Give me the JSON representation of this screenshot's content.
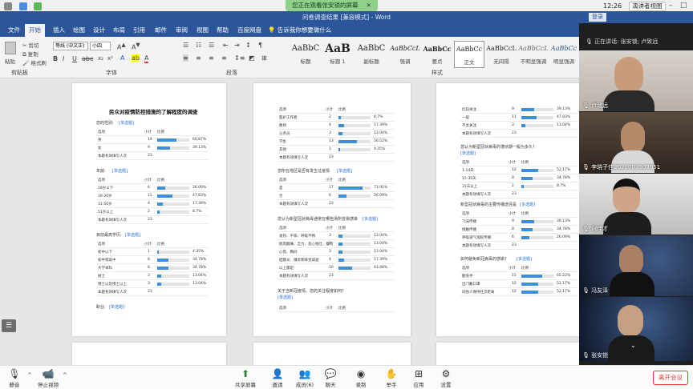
{
  "system": {
    "time": "12:26",
    "speaker_view": "演讲者视图",
    "sharing_banner": "您正在观看张安锁的屏幕"
  },
  "word": {
    "title": "问卷调查结果 [兼容模式] - Word",
    "login": "登录",
    "tabs": [
      "文件",
      "开始",
      "插入",
      "绘图",
      "设计",
      "布局",
      "引用",
      "邮件",
      "审阅",
      "视图",
      "帮助",
      "百度网盘",
      "告诉我你想要做什么"
    ],
    "clipboard": {
      "paste": "粘贴",
      "cut": "剪切",
      "copy": "复制",
      "format_painter": "格式刷",
      "group": "剪贴板"
    },
    "font": {
      "name": "等线 (中文正)",
      "size": "小四",
      "group": "字体"
    },
    "paragraph_group": "段落",
    "styles_group": "样式",
    "styles": [
      {
        "preview": "AaBbC",
        "name": "标题"
      },
      {
        "preview": "AaB",
        "name": "标题 1"
      },
      {
        "preview": "AaBbC",
        "name": "副标题"
      },
      {
        "preview": "AaBbCcL",
        "name": "强调"
      },
      {
        "preview": "AaBbCc",
        "name": "要点"
      },
      {
        "preview": "AaBbCc",
        "name": "正文"
      },
      {
        "preview": "AaBbCcL",
        "name": "无间隔"
      },
      {
        "preview": "AaBbCcL",
        "name": "不明显强调"
      },
      {
        "preview": "AaBbCc",
        "name": "明显强调"
      }
    ]
  },
  "doc": {
    "page1": {
      "title": "民众对疫情防控措施的了解程度的调查",
      "q1": "您的性别:",
      "q1_link": "[单选题]",
      "header": [
        "选项",
        "小计",
        "比例"
      ],
      "q1_rows": [
        {
          "opt": "男",
          "n": "14",
          "pct": "60.87%",
          "v": 0.6087
        },
        {
          "opt": "女",
          "n": "9",
          "pct": "39.13%",
          "v": 0.3913
        }
      ],
      "valid": "本题有效填写人次",
      "valid_n": "23",
      "q2": "年龄:",
      "q2_link": "[单选题]",
      "q2_rows": [
        {
          "opt": "18岁以下",
          "n": "6",
          "pct": "26.09%",
          "v": 0.2609
        },
        {
          "opt": "18-30岁",
          "n": "11",
          "pct": "47.83%",
          "v": 0.4783
        },
        {
          "opt": "31-50岁",
          "n": "4",
          "pct": "17.39%",
          "v": 0.1739
        },
        {
          "opt": "51岁以上",
          "n": "2",
          "pct": "8.7%",
          "v": 0.087
        }
      ],
      "q3": "目前最高学历:",
      "q3_link": "[单选题]",
      "q3_rows": [
        {
          "opt": "初中以下",
          "n": "1",
          "pct": "4.35%",
          "v": 0.0435
        },
        {
          "opt": "初中或高中",
          "n": "8",
          "pct": "34.78%",
          "v": 0.3478
        },
        {
          "opt": "大学本科",
          "n": "8",
          "pct": "34.78%",
          "v": 0.3478
        },
        {
          "opt": "硕士",
          "n": "3",
          "pct": "13.04%",
          "v": 0.1304
        },
        {
          "opt": "博士以及博士以上",
          "n": "3",
          "pct": "13.04%",
          "v": 0.1304
        }
      ],
      "q4": "职业:",
      "q4_link": "[单选题]"
    },
    "page2": {
      "rows_a": [
        {
          "opt": "医护工作者",
          "n": "2",
          "pct": "8.7%",
          "v": 0.087
        },
        {
          "opt": "教师",
          "n": "4",
          "pct": "17.39%",
          "v": 0.1739
        },
        {
          "opt": "公务员",
          "n": "3",
          "pct": "13.04%",
          "v": 0.1304
        },
        {
          "opt": "学生",
          "n": "13",
          "pct": "56.52%",
          "v": 0.5652
        },
        {
          "opt": "其他",
          "n": "1",
          "pct": "4.35%",
          "v": 0.0435
        }
      ],
      "q5": "您所在地区是否有发生过疫情",
      "q5_link": "[单选题]",
      "rows_b": [
        {
          "opt": "是",
          "n": "17",
          "pct": "73.91%",
          "v": 0.7391
        },
        {
          "opt": "否",
          "n": "6",
          "pct": "26.09%",
          "v": 0.2609
        }
      ],
      "q6": "您认为新型冠状病毒通常在哪些场所容易感染",
      "q6_link": "[多选题]",
      "rows_c": [
        {
          "opt": "发热、干咳、呼吸不畅",
          "n": "3",
          "pct": "13.04%",
          "v": 0.1304
        },
        {
          "opt": "肌肉酸痛、乏力、恶心呕吐、腹泻",
          "n": "3",
          "pct": "13.04%",
          "v": 0.1304
        },
        {
          "opt": "心慌、胸闷",
          "n": "3",
          "pct": "13.04%",
          "v": 0.1304
        },
        {
          "opt": "结膜炎、嗅觉和味觉减退",
          "n": "4",
          "pct": "17.39%",
          "v": 0.1739
        },
        {
          "opt": "以上都是",
          "n": "10",
          "pct": "43.48%",
          "v": 0.4348
        }
      ],
      "q7": "关于当新冠疫情，您的关注程度如何?",
      "q7_link": "[单选题]"
    },
    "page3": {
      "rows_a": [
        {
          "opt": "比较关注",
          "n": "9",
          "pct": "39.13%",
          "v": 0.3913
        },
        {
          "opt": "一般",
          "n": "11",
          "pct": "47.83%",
          "v": 0.4783
        },
        {
          "opt": "不太关注",
          "n": "3",
          "pct": "13.04%",
          "v": 0.1304
        }
      ],
      "q8": "您认为新型冠状病毒的潜伏期一般为多久?",
      "q8_link": "[单选题]",
      "rows_b": [
        {
          "opt": "1-14天",
          "n": "12",
          "pct": "52.17%",
          "v": 0.5217
        },
        {
          "opt": "15-30天",
          "n": "8",
          "pct": "34.78%",
          "v": 0.3478
        },
        {
          "opt": "31天以上",
          "n": "2",
          "pct": "8.7%",
          "v": 0.087
        }
      ],
      "q9": "新型冠状病毒的主要传播途径是",
      "q9_link": "[多选题]",
      "rows_c": [
        {
          "opt": "飞沫传播",
          "n": "9",
          "pct": "39.13%",
          "v": 0.3913
        },
        {
          "opt": "接触传播",
          "n": "8",
          "pct": "34.78%",
          "v": 0.3478
        },
        {
          "opt": "呼吸道气溶胶传播",
          "n": "6",
          "pct": "26.09%",
          "v": 0.2609
        }
      ],
      "q10": "如何避免新冠病毒的感染?",
      "q10_link": "[多选题]",
      "rows_d": [
        {
          "opt": "勤洗手",
          "n": "15",
          "pct": "65.22%",
          "v": 0.6522
        },
        {
          "opt": "出门戴口罩",
          "n": "12",
          "pct": "52.17%",
          "v": 0.5217
        },
        {
          "opt": "同他人保持社交距离",
          "n": "12",
          "pct": "52.17%",
          "v": 0.5217
        }
      ]
    }
  },
  "meeting": {
    "active_speaker": "正在讲话: 张安锁; 卢致远",
    "participants": [
      "卢致远",
      "李晓子佳2020003003651",
      "宿佳才",
      "冯友泽",
      "张安锁"
    ],
    "toolbar": [
      "静音",
      "停止视频",
      "共享屏幕",
      "邀请",
      "成员(6)",
      "聊天",
      "录制",
      "举手",
      "应用",
      "设置"
    ],
    "leave": "离开会议"
  }
}
